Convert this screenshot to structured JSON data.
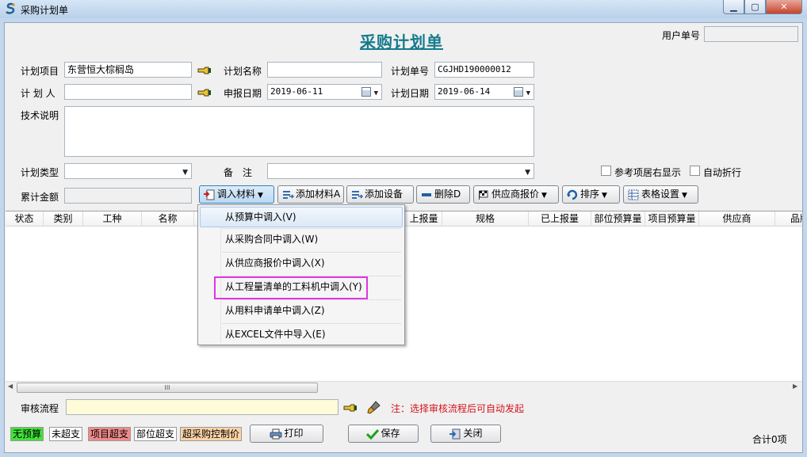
{
  "window": {
    "title": "采购计划单"
  },
  "form": {
    "title": "采购计划单",
    "user_no_label": "用户单号",
    "user_no_value": "",
    "plan_project_label": "计划项目",
    "plan_project_value": "东营恒大棕榈岛",
    "plan_name_label": "计划名称",
    "plan_name_value": "",
    "plan_no_label": "计划单号",
    "plan_no_value": "CGJHD190000012",
    "planner_label": "计 划 人",
    "planner_value": "",
    "report_date_label": "申报日期",
    "report_date_value": "2019-06-11",
    "plan_date_label": "计划日期",
    "plan_date_value": "2019-06-14",
    "tech_label": "技术说明",
    "tech_value": "",
    "plan_type_label": "计划类型",
    "plan_type_value": "",
    "remark_label": "备　注",
    "remark_value": "",
    "ref_show_right_label": "参考项居右显示",
    "auto_wrap_label": "自动折行",
    "total_amount_label": "累计金额",
    "total_amount_value": ""
  },
  "toolbar": {
    "import_material": "调入材料",
    "add_material": "添加材料A",
    "add_equipment": "添加设备",
    "delete": "删除D",
    "supplier_quote": "供应商报价",
    "sort": "排序",
    "table_settings": "表格设置"
  },
  "grid": {
    "columns": [
      "状态",
      "类别",
      "工种",
      "名称",
      "上报量",
      "规格",
      "已上报量",
      "部位预算量",
      "项目预算量",
      "供应商",
      "品牌"
    ]
  },
  "menu": {
    "items": [
      "从预算中调入(V)",
      "从采购合同中调入(W)",
      "从供应商报价中调入(X)",
      "从工程量清单的工料机中调入(Y)",
      "从用料申请单中调入(Z)",
      "从EXCEL文件中导入(E)"
    ]
  },
  "approval": {
    "label": "审核流程",
    "value": "",
    "note": "注：选择审核流程后可自动发起"
  },
  "legend": {
    "no_budget": "无预算",
    "not_over": "未超支",
    "project_over": "项目超支",
    "part_over": "部位超支",
    "over_control": "超采购控制价"
  },
  "footer": {
    "print": "打印",
    "save": "保存",
    "close": "关闭",
    "total": "合计0项"
  },
  "colors": {
    "title_teal": "#157a8c",
    "hint_red": "#d4141c",
    "legend_green": "#41e23a",
    "legend_red": "#f08a8a",
    "legend_peach": "#fbd3a6",
    "highlight_magenta": "#e135e3"
  }
}
